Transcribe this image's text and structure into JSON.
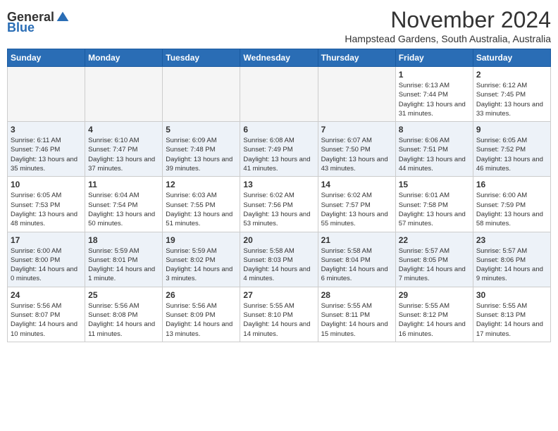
{
  "header": {
    "logo_general": "General",
    "logo_blue": "Blue",
    "month": "November 2024",
    "location": "Hampstead Gardens, South Australia, Australia"
  },
  "days_of_week": [
    "Sunday",
    "Monday",
    "Tuesday",
    "Wednesday",
    "Thursday",
    "Friday",
    "Saturday"
  ],
  "weeks": [
    [
      {
        "num": "",
        "info": ""
      },
      {
        "num": "",
        "info": ""
      },
      {
        "num": "",
        "info": ""
      },
      {
        "num": "",
        "info": ""
      },
      {
        "num": "",
        "info": ""
      },
      {
        "num": "1",
        "info": "Sunrise: 6:13 AM\nSunset: 7:44 PM\nDaylight: 13 hours and 31 minutes."
      },
      {
        "num": "2",
        "info": "Sunrise: 6:12 AM\nSunset: 7:45 PM\nDaylight: 13 hours and 33 minutes."
      }
    ],
    [
      {
        "num": "3",
        "info": "Sunrise: 6:11 AM\nSunset: 7:46 PM\nDaylight: 13 hours and 35 minutes."
      },
      {
        "num": "4",
        "info": "Sunrise: 6:10 AM\nSunset: 7:47 PM\nDaylight: 13 hours and 37 minutes."
      },
      {
        "num": "5",
        "info": "Sunrise: 6:09 AM\nSunset: 7:48 PM\nDaylight: 13 hours and 39 minutes."
      },
      {
        "num": "6",
        "info": "Sunrise: 6:08 AM\nSunset: 7:49 PM\nDaylight: 13 hours and 41 minutes."
      },
      {
        "num": "7",
        "info": "Sunrise: 6:07 AM\nSunset: 7:50 PM\nDaylight: 13 hours and 43 minutes."
      },
      {
        "num": "8",
        "info": "Sunrise: 6:06 AM\nSunset: 7:51 PM\nDaylight: 13 hours and 44 minutes."
      },
      {
        "num": "9",
        "info": "Sunrise: 6:05 AM\nSunset: 7:52 PM\nDaylight: 13 hours and 46 minutes."
      }
    ],
    [
      {
        "num": "10",
        "info": "Sunrise: 6:05 AM\nSunset: 7:53 PM\nDaylight: 13 hours and 48 minutes."
      },
      {
        "num": "11",
        "info": "Sunrise: 6:04 AM\nSunset: 7:54 PM\nDaylight: 13 hours and 50 minutes."
      },
      {
        "num": "12",
        "info": "Sunrise: 6:03 AM\nSunset: 7:55 PM\nDaylight: 13 hours and 51 minutes."
      },
      {
        "num": "13",
        "info": "Sunrise: 6:02 AM\nSunset: 7:56 PM\nDaylight: 13 hours and 53 minutes."
      },
      {
        "num": "14",
        "info": "Sunrise: 6:02 AM\nSunset: 7:57 PM\nDaylight: 13 hours and 55 minutes."
      },
      {
        "num": "15",
        "info": "Sunrise: 6:01 AM\nSunset: 7:58 PM\nDaylight: 13 hours and 57 minutes."
      },
      {
        "num": "16",
        "info": "Sunrise: 6:00 AM\nSunset: 7:59 PM\nDaylight: 13 hours and 58 minutes."
      }
    ],
    [
      {
        "num": "17",
        "info": "Sunrise: 6:00 AM\nSunset: 8:00 PM\nDaylight: 14 hours and 0 minutes."
      },
      {
        "num": "18",
        "info": "Sunrise: 5:59 AM\nSunset: 8:01 PM\nDaylight: 14 hours and 1 minute."
      },
      {
        "num": "19",
        "info": "Sunrise: 5:59 AM\nSunset: 8:02 PM\nDaylight: 14 hours and 3 minutes."
      },
      {
        "num": "20",
        "info": "Sunrise: 5:58 AM\nSunset: 8:03 PM\nDaylight: 14 hours and 4 minutes."
      },
      {
        "num": "21",
        "info": "Sunrise: 5:58 AM\nSunset: 8:04 PM\nDaylight: 14 hours and 6 minutes."
      },
      {
        "num": "22",
        "info": "Sunrise: 5:57 AM\nSunset: 8:05 PM\nDaylight: 14 hours and 7 minutes."
      },
      {
        "num": "23",
        "info": "Sunrise: 5:57 AM\nSunset: 8:06 PM\nDaylight: 14 hours and 9 minutes."
      }
    ],
    [
      {
        "num": "24",
        "info": "Sunrise: 5:56 AM\nSunset: 8:07 PM\nDaylight: 14 hours and 10 minutes."
      },
      {
        "num": "25",
        "info": "Sunrise: 5:56 AM\nSunset: 8:08 PM\nDaylight: 14 hours and 11 minutes."
      },
      {
        "num": "26",
        "info": "Sunrise: 5:56 AM\nSunset: 8:09 PM\nDaylight: 14 hours and 13 minutes."
      },
      {
        "num": "27",
        "info": "Sunrise: 5:55 AM\nSunset: 8:10 PM\nDaylight: 14 hours and 14 minutes."
      },
      {
        "num": "28",
        "info": "Sunrise: 5:55 AM\nSunset: 8:11 PM\nDaylight: 14 hours and 15 minutes."
      },
      {
        "num": "29",
        "info": "Sunrise: 5:55 AM\nSunset: 8:12 PM\nDaylight: 14 hours and 16 minutes."
      },
      {
        "num": "30",
        "info": "Sunrise: 5:55 AM\nSunset: 8:13 PM\nDaylight: 14 hours and 17 minutes."
      }
    ]
  ]
}
